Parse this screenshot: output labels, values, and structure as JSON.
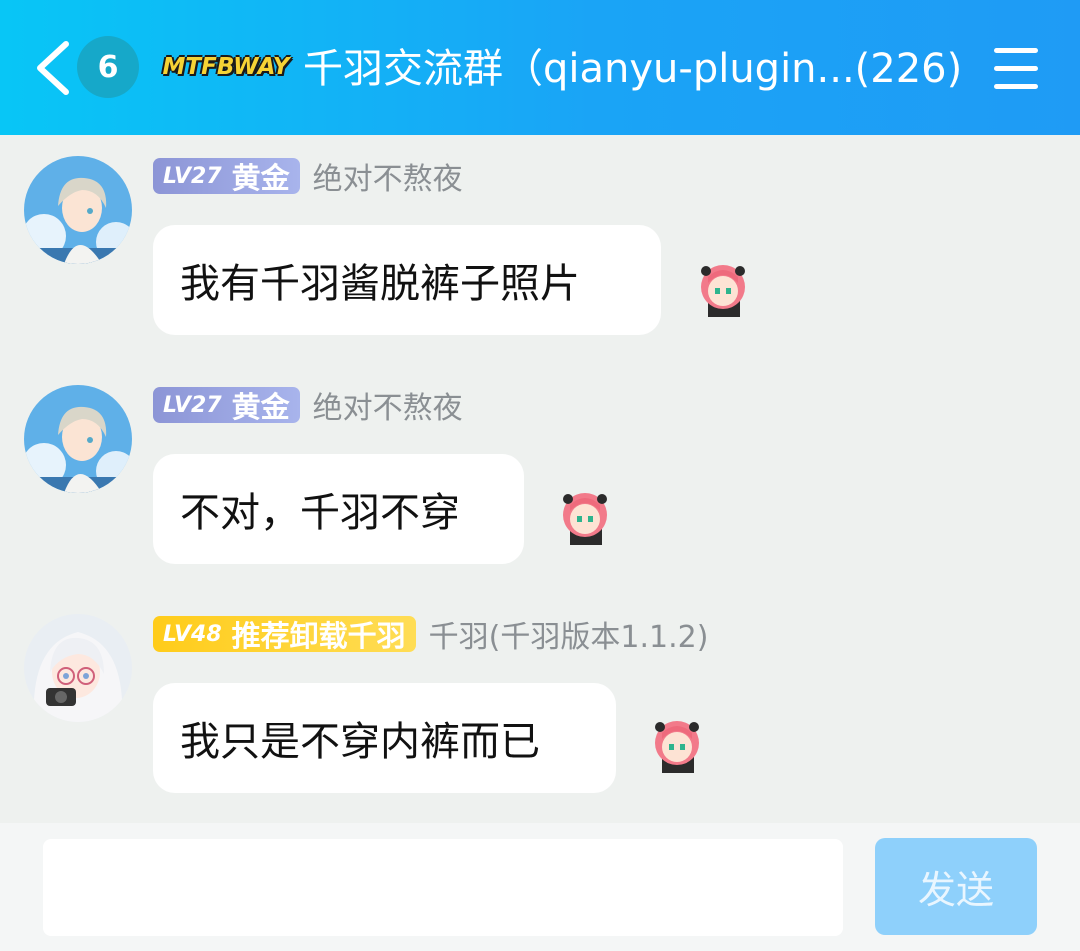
{
  "header": {
    "unread_count": "6",
    "group_badge": "MTFBWAY",
    "title": "千羽交流群（qianyu-plugin...(226)"
  },
  "messages": [
    {
      "level": "LV27",
      "level_title": "黄金",
      "badge_color": "#a3acdf",
      "nickname": "绝对不熬夜",
      "text": "我有千羽酱脱裤子照片",
      "avatar": "anime-boy-avatar"
    },
    {
      "level": "LV27",
      "level_title": "黄金",
      "badge_color": "#a3acdf",
      "nickname": "绝对不熬夜",
      "text": "不对，千羽不穿",
      "avatar": "anime-boy-avatar"
    },
    {
      "level": "LV48",
      "level_title": "推荐卸载千羽",
      "badge_color": "#ffd233",
      "nickname": "千羽(千羽版本1.1.2)",
      "text": "我只是不穿内裤而已",
      "avatar": "anime-girl-avatar"
    }
  ],
  "input": {
    "value": "",
    "send_label": "发送"
  },
  "colors": {
    "header": "#12b4f6",
    "background": "#eef1ef",
    "send_button": "#8ed0fb"
  }
}
